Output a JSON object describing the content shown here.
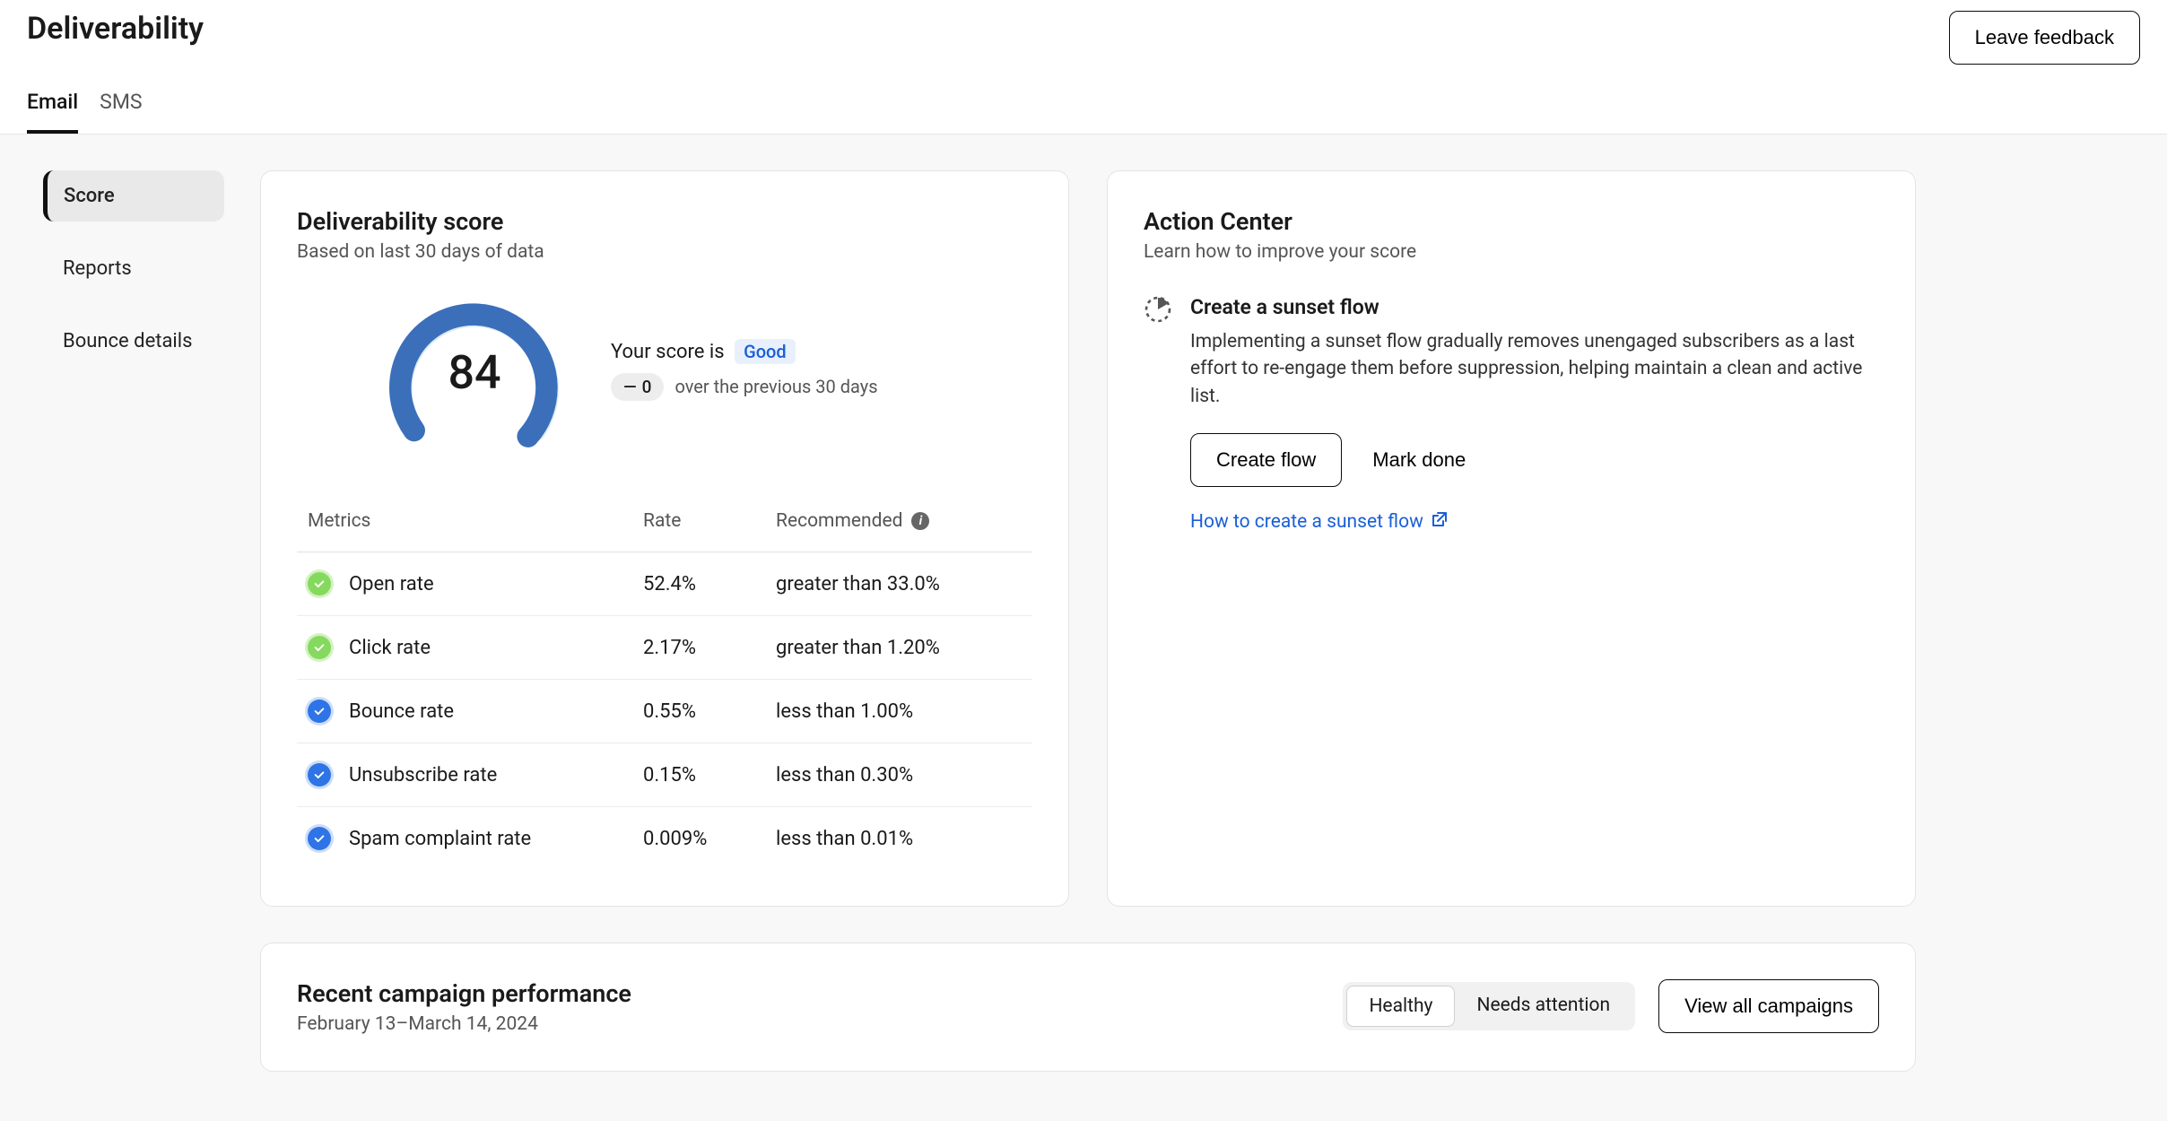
{
  "header": {
    "title": "Deliverability",
    "feedback_label": "Leave feedback"
  },
  "tabs": {
    "email": "Email",
    "sms": "SMS"
  },
  "sidebar": {
    "score": "Score",
    "reports": "Reports",
    "bounce": "Bounce details"
  },
  "score_card": {
    "title": "Deliverability score",
    "subtitle": "Based on last 30 days of data",
    "score": "84",
    "your_score_is": "Your score is",
    "status": "Good",
    "delta_value": "0",
    "delta_note": "over the previous 30 days",
    "col_metrics": "Metrics",
    "col_rate": "Rate",
    "col_recommended": "Recommended",
    "metrics": [
      {
        "name": "Open rate",
        "rate": "52.4%",
        "rec": "greater than 33.0%",
        "status": "green"
      },
      {
        "name": "Click rate",
        "rate": "2.17%",
        "rec": "greater than 1.20%",
        "status": "green"
      },
      {
        "name": "Bounce rate",
        "rate": "0.55%",
        "rec": "less than 1.00%",
        "status": "blue"
      },
      {
        "name": "Unsubscribe rate",
        "rate": "0.15%",
        "rec": "less than 0.30%",
        "status": "blue"
      },
      {
        "name": "Spam complaint rate",
        "rate": "0.009%",
        "rec": "less than 0.01%",
        "status": "blue"
      }
    ]
  },
  "action_card": {
    "title": "Action Center",
    "subtitle": "Learn how to improve your score",
    "item_title": "Create a sunset flow",
    "item_desc": "Implementing a sunset flow gradually removes unengaged subscribers as a last effort to re-engage them before suppression, helping maintain a clean and active list.",
    "create_flow_label": "Create flow",
    "mark_done_label": "Mark done",
    "how_to_link": "How to create a sunset flow"
  },
  "campaign_card": {
    "title": "Recent campaign performance",
    "date_range": "February 13–March 14, 2024",
    "seg_healthy": "Healthy",
    "seg_needs": "Needs attention",
    "view_all": "View all campaigns"
  },
  "chart_data": {
    "type": "gauge",
    "value": 84,
    "min": 0,
    "max": 100,
    "label": "Deliverability score",
    "status": "Good"
  }
}
